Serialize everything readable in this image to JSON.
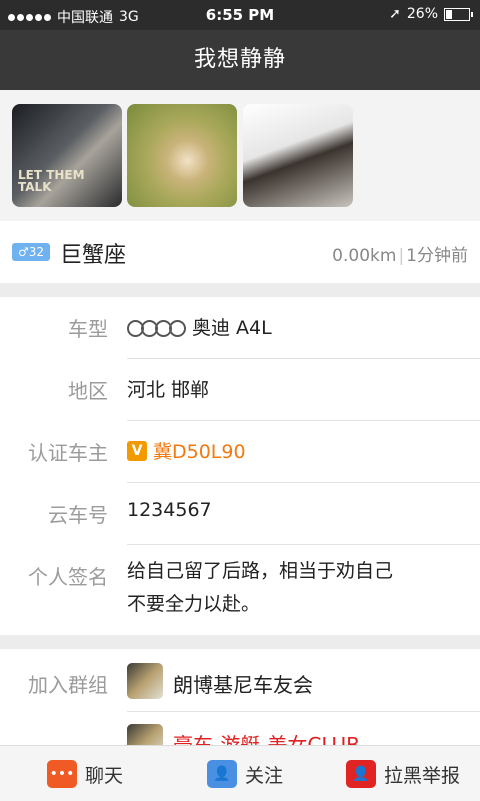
{
  "status": {
    "carrier": "中国联通",
    "network": "3G",
    "time": "6:55 PM",
    "battery": "26%",
    "battery_level": 0.26
  },
  "nav": {
    "title": "我想静静"
  },
  "photos": [
    {
      "id": "photo-1",
      "overlay_text": "LET THEM TALK"
    },
    {
      "id": "photo-2"
    },
    {
      "id": "photo-3"
    }
  ],
  "profile": {
    "gender_symbol": "♂",
    "age": "32",
    "zodiac": "巨蟹座",
    "distance": "0.00km",
    "last_seen": "1分钟前"
  },
  "info": {
    "car_type": {
      "label": "车型",
      "value": "奥迪  A4L"
    },
    "region": {
      "label": "地区",
      "value": "河北 邯郸"
    },
    "verified": {
      "label": "认证车主",
      "badge": "V",
      "value": "冀D50L90"
    },
    "cloud_id": {
      "label": "云车号",
      "value": "1234567"
    },
    "signature": {
      "label": "个人签名",
      "line1": "给自己留了后路，相当于劝自己",
      "line2": "不要全力以赴。"
    }
  },
  "groups": {
    "label": "加入群组",
    "items": [
      {
        "name": "朗博基尼车友会",
        "color": "#222222"
      },
      {
        "name": "豪车-游艇-美女CLUB",
        "color": "#e02020"
      }
    ]
  },
  "tabs": [
    {
      "label": "聊天",
      "icon": "chat-icon",
      "color": "#f05a24"
    },
    {
      "label": "关注",
      "icon": "follow-icon",
      "color": "#4a90e2"
    },
    {
      "label": "拉黑举报",
      "icon": "block-icon",
      "color": "#e02424"
    }
  ]
}
